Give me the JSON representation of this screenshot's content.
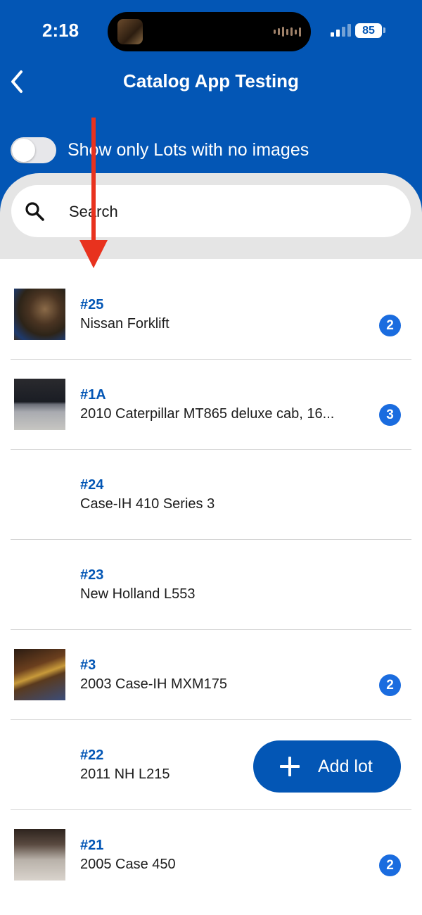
{
  "status_bar": {
    "time": "2:18",
    "battery": "85"
  },
  "header": {
    "title": "Catalog App Testing",
    "back_icon": "chevron-left-icon"
  },
  "filter": {
    "toggle_label": "Show only Lots with no images",
    "toggle_on": false
  },
  "search": {
    "placeholder": "Search",
    "icon": "search-icon"
  },
  "lots": [
    {
      "number": "#25",
      "title": "Nissan Forklift",
      "image_count": "2",
      "has_image": true
    },
    {
      "number": "#1A",
      "title": "2010 Caterpillar MT865 deluxe cab, 16...",
      "image_count": "3",
      "has_image": true
    },
    {
      "number": "#24",
      "title": "Case-IH 410 Series 3",
      "image_count": "",
      "has_image": false
    },
    {
      "number": "#23",
      "title": "New Holland L553",
      "image_count": "",
      "has_image": false
    },
    {
      "number": "#3",
      "title": "2003 Case-IH MXM175",
      "image_count": "2",
      "has_image": true
    },
    {
      "number": "#22",
      "title": "2011 NH L215",
      "image_count": "",
      "has_image": false
    },
    {
      "number": "#21",
      "title": "2005 Case 450",
      "image_count": "2",
      "has_image": true
    }
  ],
  "add_lot": {
    "label": "Add lot",
    "icon": "plus-icon"
  },
  "colors": {
    "brand_blue": "#0356b5",
    "badge_blue": "#1a6cdf",
    "annotation_arrow": "#e8321e"
  }
}
